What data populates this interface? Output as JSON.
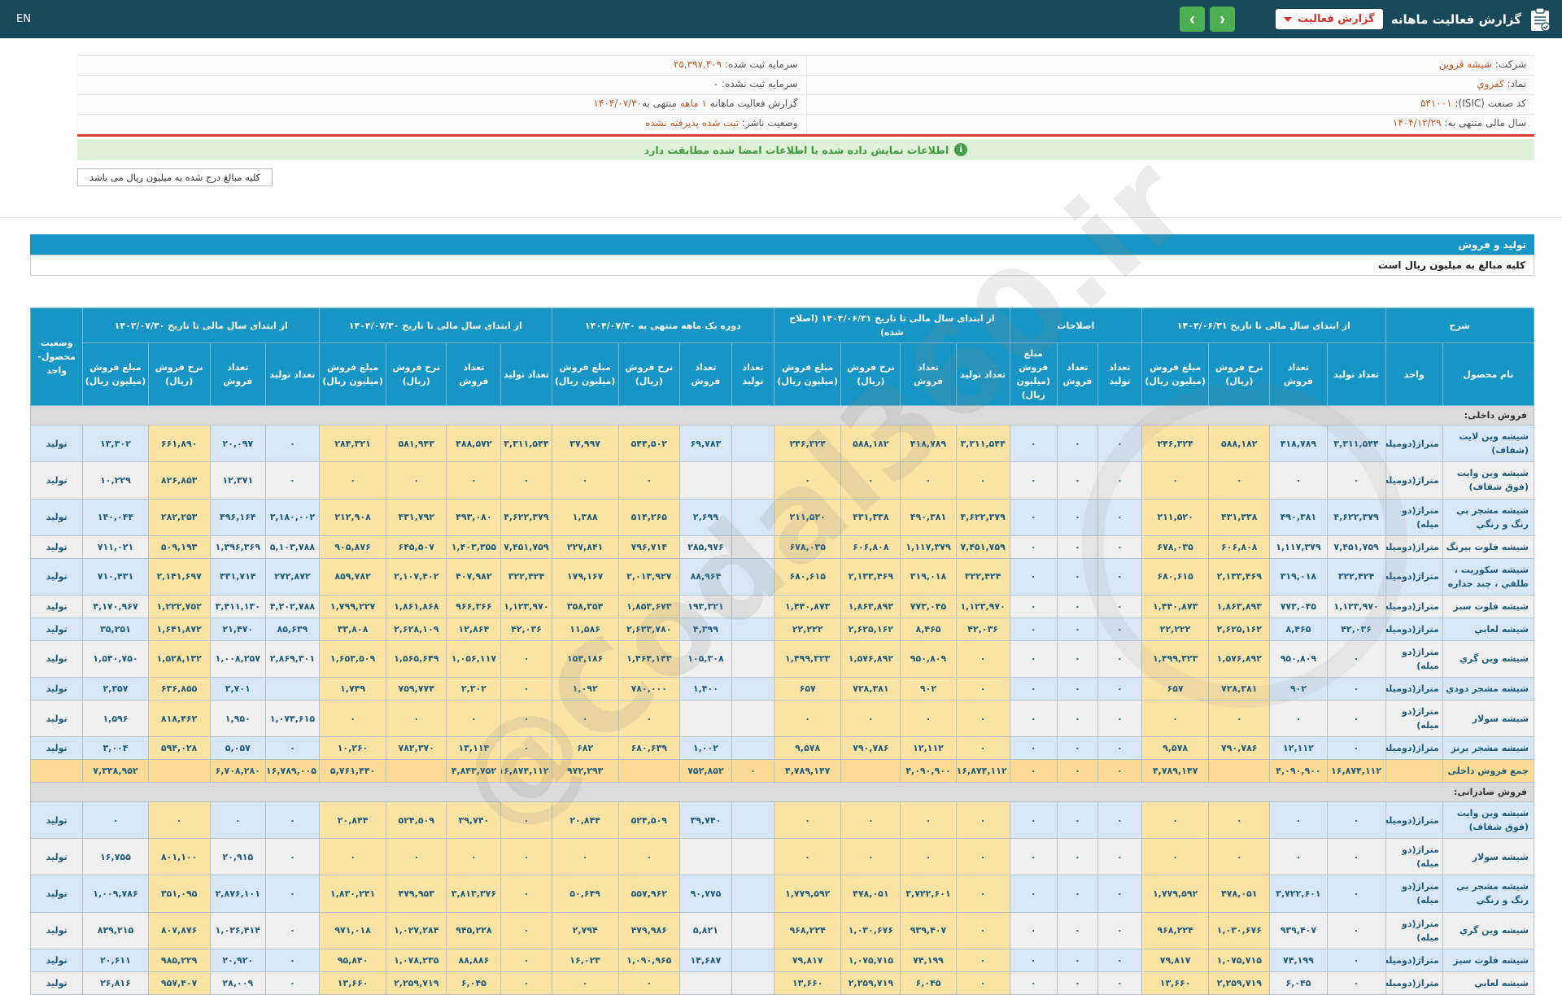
{
  "topbar": {
    "language": "EN",
    "title": "گزارش فعالیت ماهانه",
    "dropdown_label": "گزارش فعالیت",
    "icons": {
      "report": "clipboard-icon",
      "dropdown_caret": "chevron-down-icon",
      "nav_prev": "chevron-left-icon",
      "nav_next": "chevron-right-icon"
    },
    "colors": {
      "bar": "#17495A",
      "nav_button": "#4CAF50",
      "dropdown_text": "#D6342C"
    }
  },
  "info": {
    "company_label": "شرکت:",
    "company": "شیشه قزوین",
    "symbol_label": "نماد:",
    "symbol": "کفزوي",
    "isic_label": "کد صنعت (ISIC):",
    "isic": "۵۴۱۰۰۱",
    "fiscal_label": "سال مالی منتهی به:",
    "fiscal": "۱۴۰۴/۱۲/۲۹",
    "cap_reg_label": "سرمایه ثبت شده:",
    "cap_reg": "۲۵,۳۹۷,۴۰۹",
    "cap_unreg_label": "سرمایه ثبت نشده:",
    "cap_unreg": "۰",
    "report_label": "گزارش فعالیت ماهانه",
    "report_period": "۱ ماهه",
    "report_to": "منتهی به",
    "report_date": "۱۴۰۴/۰۷/۳۰",
    "status_label": "وضعیت ناشر:",
    "status": "ثبت شده پذیرفته نشده"
  },
  "notice": {
    "signed": "اطلاعات نمایش داده شده با اطلاعات امضا شده مطابقت دارد",
    "amounts_box": "کلیه مبالغ درج شده به میلیون ریال می باشد"
  },
  "section": {
    "title": "تولید و فروش",
    "note": "کلیه مبالغ به میلیون ریال است"
  },
  "watermark": {
    "text": "@Codal360.ir"
  },
  "table": {
    "head": [
      {
        "label": "شرح",
        "cols": [
          "نام محصول",
          "واحد"
        ]
      },
      {
        "label": "از ابتدای سال مالی تا تاریخ ۱۴۰۴/۰۶/۳۱",
        "cols": [
          "تعداد تولید",
          "تعداد فروش",
          "نرخ فروش (ریال)",
          "مبلغ فروش (میلیون ریال)"
        ]
      },
      {
        "label": "اصلاحات",
        "cols": [
          "تعداد تولید",
          "تعداد فروش",
          "مبلغ فروش (میلیون ریال)"
        ]
      },
      {
        "label": "از ابتدای سال مالی تا تاریخ ۱۴۰۴/۰۶/۳۱ (اصلاح شده)",
        "cols": [
          "تعداد تولید",
          "تعداد فروش",
          "نرخ فروش (ریال)",
          "مبلغ فروش (میلیون ریال)"
        ]
      },
      {
        "label": "دوره یک ماهه منتهی به ۱۴۰۴/۰۷/۳۰",
        "cols": [
          "تعداد تولید",
          "تعداد فروش",
          "نرخ فروش (ریال)",
          "مبلغ فروش (میلیون ریال)"
        ]
      },
      {
        "label": "از ابتدای سال مالی تا تاریخ ۱۴۰۴/۰۷/۳۰",
        "cols": [
          "تعداد تولید",
          "تعداد فروش",
          "نرخ فروش (ریال)",
          "مبلغ فروش (میلیون ریال)"
        ]
      },
      {
        "label": "از ابتدای سال مالی تا تاریخ ۱۴۰۳/۰۷/۳۰",
        "cols": [
          "تعداد تولید",
          "تعداد فروش",
          "نرخ فروش (ریال)",
          "مبلغ فروش (میلیون ریال)"
        ]
      },
      {
        "label": "وضعیت محصول-واحد",
        "cols": []
      }
    ],
    "sections": [
      {
        "label": "فروش داخلی:",
        "rows": [
          {
            "name": "شیشه وین لایت (شفاف)",
            "unit": "متراژ(دومیله)",
            "status": "تولید",
            "g2": [
              "۳,۳۱۱,۵۴۴",
              "۴۱۸,۷۸۹",
              "۵۸۸,۱۸۲",
              "۲۴۶,۳۲۴"
            ],
            "adj": [
              "۰",
              "۰",
              "۰"
            ],
            "g4": [
              "۳,۳۱۱,۵۴۴",
              "۴۱۸,۷۸۹",
              "۵۸۸,۱۸۲",
              "۲۴۶,۳۲۴"
            ],
            "g5": [
              "",
              "۶۹,۷۸۳",
              "۵۴۴,۵۰۲",
              "۳۷,۹۹۷"
            ],
            "g6": [
              "۳,۳۱۱,۵۴۴",
              "۴۸۸,۵۷۲",
              "۵۸۱,۹۴۳",
              "۲۸۴,۳۲۱"
            ],
            "g7": [
              "۰",
              "۲۰,۰۹۷",
              "۶۶۱,۸۹۰",
              "۱۳,۳۰۲"
            ]
          },
          {
            "name": "شیشه وین وایت (فوق شفاف)",
            "unit": "متراژ(دومیله)",
            "status": "تولید",
            "g2": [
              "۰",
              "۰",
              "۰",
              "۰"
            ],
            "adj": [
              "۰",
              "۰",
              "۰"
            ],
            "g4": [
              "۰",
              "۰",
              "۰",
              "۰"
            ],
            "g5": [
              "",
              "",
              "۰",
              "۰"
            ],
            "g6": [
              "۰",
              "۰",
              "۰",
              "۰"
            ],
            "g7": [
              "۰",
              "۱۲,۳۷۱",
              "۸۲۶,۸۵۳",
              "۱۰,۲۲۹"
            ]
          },
          {
            "name": "شیشه مشجر بي رنگ و رنگي",
            "unit": "متراژ(دو میله)",
            "status": "تولید",
            "g2": [
              "۴,۶۲۲,۳۷۹",
              "۴۹۰,۳۸۱",
              "۴۳۱,۳۳۸",
              "۲۱۱,۵۲۰"
            ],
            "adj": [
              "۰",
              "۰",
              "۰"
            ],
            "g4": [
              "۴,۶۲۲,۳۷۹",
              "۴۹۰,۳۸۱",
              "۴۳۱,۳۳۸",
              "۲۱۱,۵۲۰"
            ],
            "g5": [
              "",
              "۲,۶۹۹",
              "۵۱۴,۲۶۵",
              "۱,۳۸۸"
            ],
            "g6": [
              "۴,۶۲۲,۳۷۹",
              "۴۹۳,۰۸۰",
              "۴۳۱,۷۹۲",
              "۲۱۲,۹۰۸"
            ],
            "g7": [
              "۳,۱۸۰,۰۰۲",
              "۴۹۶,۱۶۴",
              "۲۸۲,۲۵۳",
              "۱۴۰,۰۴۴"
            ]
          },
          {
            "name": "شیشه فلوت بیرنگ",
            "unit": "متراژ(دومیله)",
            "status": "تولید",
            "g2": [
              "۷,۴۵۱,۷۵۹",
              "۱,۱۱۷,۳۷۹",
              "۶۰۶,۸۰۸",
              "۶۷۸,۰۳۵"
            ],
            "adj": [
              "۰",
              "۰",
              "۰"
            ],
            "g4": [
              "۷,۴۵۱,۷۵۹",
              "۱,۱۱۷,۳۷۹",
              "۶۰۶,۸۰۸",
              "۶۷۸,۰۳۵"
            ],
            "g5": [
              "",
              "۲۸۵,۹۷۶",
              "۷۹۶,۷۱۴",
              "۲۲۷,۸۴۱"
            ],
            "g6": [
              "۷,۴۵۱,۷۵۹",
              "۱,۴۰۳,۳۵۵",
              "۶۴۵,۵۰۷",
              "۹۰۵,۸۷۶"
            ],
            "g7": [
              "۵,۱۰۳,۷۸۸",
              "۱,۳۹۶,۳۶۹",
              "۵۰۹,۱۹۳",
              "۷۱۱,۰۲۱"
            ]
          },
          {
            "name": "شیشه سکوریت ، طلقي ، چند جداره",
            "unit": "متراژ(دومیله)",
            "status": "تولید",
            "g2": [
              "۳۲۲,۴۲۴",
              "۳۱۹,۰۱۸",
              "۲,۱۳۳,۴۶۹",
              "۶۸۰,۶۱۵"
            ],
            "adj": [
              "۰",
              "۰",
              "۰"
            ],
            "g4": [
              "۳۲۲,۴۲۴",
              "۳۱۹,۰۱۸",
              "۲,۱۳۳,۴۶۹",
              "۶۸۰,۶۱۵"
            ],
            "g5": [
              "",
              "۸۸,۹۶۴",
              "۲,۰۱۳,۹۲۷",
              "۱۷۹,۱۶۷"
            ],
            "g6": [
              "۳۲۲,۴۲۴",
              "۴۰۷,۹۸۲",
              "۲,۱۰۷,۴۰۲",
              "۸۵۹,۷۸۲"
            ],
            "g7": [
              "۲۷۲,۸۷۲",
              "۳۳۱,۷۱۴",
              "۲,۱۴۱,۶۹۷",
              "۷۱۰,۴۳۱"
            ]
          },
          {
            "name": "شیشه فلوت سبز",
            "unit": "متراژ(دومیله)",
            "status": "تولید",
            "g2": [
              "۱,۱۲۳,۹۷۰",
              "۷۷۳,۰۴۵",
              "۱,۸۶۳,۸۹۳",
              "۱,۴۴۰,۸۷۳"
            ],
            "adj": [
              "۰",
              "۰",
              "۰"
            ],
            "g4": [
              "۱,۱۲۳,۹۷۰",
              "۷۷۳,۰۴۵",
              "۱,۸۶۳,۸۹۳",
              "۱,۴۴۰,۸۷۳"
            ],
            "g5": [
              "",
              "۱۹۳,۳۲۱",
              "۱,۸۵۳,۶۷۳",
              "۳۵۸,۳۵۴"
            ],
            "g6": [
              "۱,۱۲۳,۹۷۰",
              "۹۶۶,۳۶۶",
              "۱,۸۶۱,۸۶۸",
              "۱,۷۹۹,۲۲۷"
            ],
            "g7": [
              "۴,۲۰۲,۷۸۸",
              "۳,۴۱۱,۱۳۰",
              "۱,۲۲۲,۷۵۲",
              "۴,۱۷۰,۹۶۷"
            ]
          },
          {
            "name": "شیشه لعابي",
            "unit": "متراژ(دومیله)",
            "status": "تولید",
            "g2": [
              "۴۲,۰۳۶",
              "۸,۴۶۵",
              "۲,۶۲۵,۱۶۲",
              "۲۲,۲۲۲"
            ],
            "adj": [
              "۰",
              "۰",
              "۰"
            ],
            "g4": [
              "۴۲,۰۳۶",
              "۸,۴۶۵",
              "۲,۶۲۵,۱۶۲",
              "۲۲,۲۲۲"
            ],
            "g5": [
              "",
              "۴,۳۹۹",
              "۲,۶۳۳,۷۸۰",
              "۱۱,۵۸۶"
            ],
            "g6": [
              "۴۲,۰۳۶",
              "۱۲,۸۶۴",
              "۲,۶۲۸,۱۰۹",
              "۳۳,۸۰۸"
            ],
            "g7": [
              "۸۵,۶۳۹",
              "۲۱,۴۷۰",
              "۱,۶۴۱,۸۷۲",
              "۳۵,۲۵۱"
            ]
          },
          {
            "name": "شیشه وین گري",
            "unit": "متراژ(دو میله)",
            "status": "تولید",
            "g2": [
              "۰",
              "۹۵۰,۸۰۹",
              "۱,۵۷۶,۸۹۲",
              "۱,۴۹۹,۳۲۳"
            ],
            "adj": [
              "۰",
              "۰",
              "۰"
            ],
            "g4": [
              "۰",
              "۹۵۰,۸۰۹",
              "۱,۵۷۶,۸۹۲",
              "۱,۴۹۹,۳۲۳"
            ],
            "g5": [
              "",
              "۱۰۵,۳۰۸",
              "۱,۴۶۴,۱۴۳",
              "۱۵۴,۱۸۶"
            ],
            "g6": [
              "۰",
              "۱,۰۵۶,۱۱۷",
              "۱,۵۶۵,۶۴۹",
              "۱,۶۵۳,۵۰۹"
            ],
            "g7": [
              "۲,۸۶۹,۳۰۱",
              "۱,۰۰۸,۲۵۷",
              "۱,۵۲۸,۱۳۲",
              "۱,۵۴۰,۷۵۰"
            ]
          },
          {
            "name": "شیشه مشجر دودي",
            "unit": "متراژ(دومیله)",
            "status": "تولید",
            "g2": [
              "۰",
              "۹۰۲",
              "۷۲۸,۳۸۱",
              "۶۵۷"
            ],
            "adj": [
              "۰",
              "۰",
              "۰"
            ],
            "g4": [
              "۰",
              "۹۰۲",
              "۷۲۸,۳۸۱",
              "۶۵۷"
            ],
            "g5": [
              "",
              "۱,۴۰۰",
              "۷۸۰,۰۰۰",
              "۱,۰۹۲"
            ],
            "g6": [
              "۰",
              "۲,۳۰۲",
              "۷۵۹,۷۷۴",
              "۱,۷۴۹"
            ],
            "g7": [
              "",
              "۳,۷۰۱",
              "۶۳۶,۸۵۵",
              "۲,۳۵۷"
            ]
          },
          {
            "name": "شیشه سولار",
            "unit": "متراژ(دو میله)",
            "status": "تولید",
            "g2": [
              "۰",
              "۰",
              "۰",
              "۰"
            ],
            "adj": [
              "۰",
              "۰",
              "۰"
            ],
            "g4": [
              "۰",
              "۰",
              "۰",
              "۰"
            ],
            "g5": [
              "",
              "",
              "۰",
              "۰"
            ],
            "g6": [
              "۰",
              "۰",
              "۰",
              "۰"
            ],
            "g7": [
              "۱,۰۷۴,۶۱۵",
              "۱,۹۵۰",
              "۸۱۸,۴۶۲",
              "۱,۵۹۶"
            ]
          },
          {
            "name": "شیشه مشجر برنز",
            "unit": "متراژ(دومیله)",
            "status": "تولید",
            "g2": [
              "۰",
              "۱۲,۱۱۲",
              "۷۹۰,۷۸۶",
              "۹,۵۷۸"
            ],
            "adj": [
              "۰",
              "۰",
              "۰"
            ],
            "g4": [
              "۰",
              "۱۲,۱۱۲",
              "۷۹۰,۷۸۶",
              "۹,۵۷۸"
            ],
            "g5": [
              "",
              "۱,۰۰۲",
              "۶۸۰,۶۳۹",
              "۶۸۲"
            ],
            "g6": [
              "۰",
              "۱۳,۱۱۴",
              "۷۸۲,۳۷۰",
              "۱۰,۲۶۰"
            ],
            "g7": [
              "۰",
              "۵,۰۵۷",
              "۵۹۴,۰۲۸",
              "۳,۰۰۴"
            ]
          },
          {
            "name": "جمع فروش داخلی",
            "unit": "",
            "status": "",
            "total": true,
            "g2": [
              "۱۶,۸۷۴,۱۱۲",
              "۴,۰۹۰,۹۰۰",
              "",
              "۴,۷۸۹,۱۴۷"
            ],
            "adj": [
              "۰",
              "۰",
              "۰"
            ],
            "g4": [
              "۱۶,۸۷۴,۱۱۲",
              "۴,۰۹۰,۹۰۰",
              "",
              "۴,۷۸۹,۱۴۷"
            ],
            "g5": [
              "۰",
              "۷۵۲,۸۵۲",
              "",
              "۹۷۲,۲۹۳"
            ],
            "g6": [
              "۱۶,۸۷۴,۱۱۲",
              "۴,۸۴۳,۷۵۲",
              "",
              "۵,۷۶۱,۴۴۰"
            ],
            "g7": [
              "۱۶,۷۸۹,۰۰۵",
              "۶,۷۰۸,۲۸۰",
              "",
              "۷,۳۳۸,۹۵۲"
            ]
          }
        ]
      },
      {
        "label": "فروش صادراتی:",
        "rows": [
          {
            "name": "شیشه وین وایت (فوق شفاف)",
            "unit": "متراژ(دومیله)",
            "status": "تولید",
            "g2": [
              "۰",
              "۰",
              "۰",
              "۰"
            ],
            "adj": [
              "۰",
              "۰",
              "۰"
            ],
            "g4": [
              "۰",
              "۰",
              "۰",
              "۰"
            ],
            "g5": [
              "",
              "۳۹,۷۴۰",
              "۵۲۴,۵۰۹",
              "۲۰,۸۴۴"
            ],
            "g6": [
              "۰",
              "۳۹,۷۴۰",
              "۵۲۴,۵۰۹",
              "۲۰,۸۴۴"
            ],
            "g7": [
              "۰",
              "۰",
              "۰",
              "۰"
            ]
          },
          {
            "name": "شیشه سولار",
            "unit": "متراژ(دو میله)",
            "status": "تولید",
            "g2": [
              "۰",
              "۰",
              "۰",
              "۰"
            ],
            "adj": [
              "۰",
              "۰",
              "۰"
            ],
            "g4": [
              "۰",
              "۰",
              "۰",
              "۰"
            ],
            "g5": [
              "",
              "",
              "۰",
              "۰"
            ],
            "g6": [
              "۰",
              "۰",
              "۰",
              "۰"
            ],
            "g7": [
              "۰",
              "۲۰,۹۱۵",
              "۸۰۱,۱۰۰",
              "۱۶,۷۵۵"
            ]
          },
          {
            "name": "شیشه مشجر بي رنگ و رنگي",
            "unit": "متراژ(دو میله)",
            "status": "تولید",
            "g2": [
              "۰",
              "۳,۷۲۲,۶۰۱",
              "۴۷۸,۰۵۱",
              "۱,۷۷۹,۵۹۲"
            ],
            "adj": [
              "۰",
              "۰",
              "۰"
            ],
            "g4": [
              "۰",
              "۳,۷۲۲,۶۰۱",
              "۴۷۸,۰۵۱",
              "۱,۷۷۹,۵۹۲"
            ],
            "g5": [
              "",
              "۹۰,۷۷۵",
              "۵۵۷,۹۶۲",
              "۵۰,۶۴۹"
            ],
            "g6": [
              "۰",
              "۳,۸۱۳,۳۷۶",
              "۴۷۹,۹۵۳",
              "۱,۸۳۰,۲۴۱"
            ],
            "g7": [
              "۰",
              "۲,۸۷۶,۱۰۱",
              "۳۵۱,۰۹۵",
              "۱,۰۰۹,۷۸۶"
            ]
          },
          {
            "name": "شیشه وین گري",
            "unit": "متراژ(دو میله)",
            "status": "تولید",
            "g2": [
              "۰",
              "۹۳۹,۴۰۷",
              "۱,۰۳۰,۶۷۶",
              "۹۶۸,۲۲۴"
            ],
            "adj": [
              "۰",
              "۰",
              "۰"
            ],
            "g4": [
              "۰",
              "۹۳۹,۴۰۷",
              "۱,۰۳۰,۶۷۶",
              "۹۶۸,۲۲۴"
            ],
            "g5": [
              "",
              "۵,۸۲۱",
              "۴۷۹,۹۸۶",
              "۲,۷۹۴"
            ],
            "g6": [
              "۰",
              "۹۴۵,۲۲۸",
              "۱,۰۲۷,۲۸۴",
              "۹۷۱,۰۱۸"
            ],
            "g7": [
              "۰",
              "۱,۰۲۶,۴۱۴",
              "۸۰۷,۸۷۶",
              "۸۲۹,۲۱۵"
            ]
          },
          {
            "name": "شیشه فلوت سبز",
            "unit": "متراژ(دومیله)",
            "status": "تولید",
            "g2": [
              "۰",
              "۷۴,۱۹۹",
              "۱,۰۷۵,۷۱۵",
              "۷۹,۸۱۷"
            ],
            "adj": [
              "۰",
              "۰",
              "۰"
            ],
            "g4": [
              "۰",
              "۷۴,۱۹۹",
              "۱,۰۷۵,۷۱۵",
              "۷۹,۸۱۷"
            ],
            "g5": [
              "",
              "۱۴,۶۸۷",
              "۱,۰۹۰,۹۶۵",
              "۱۶,۰۲۳"
            ],
            "g6": [
              "۰",
              "۸۸,۸۸۶",
              "۱,۰۷۸,۲۳۵",
              "۹۵,۸۴۰"
            ],
            "g7": [
              "۰",
              "۲۰,۹۲۰",
              "۹۸۵,۲۲۹",
              "۲۰,۶۱۱"
            ]
          },
          {
            "name": "شیشه لعابي",
            "unit": "متراژ(دومیله)",
            "status": "تولید",
            "g2": [
              "۰",
              "۶,۰۴۵",
              "۲,۲۵۹,۷۱۹",
              "۱۳,۶۶۰"
            ],
            "adj": [
              "۰",
              "۰",
              "۰"
            ],
            "g4": [
              "۰",
              "۶,۰۴۵",
              "۲,۲۵۹,۷۱۹",
              "۱۳,۶۶۰"
            ],
            "g5": [
              "",
              "",
              "۰",
              "۰"
            ],
            "g6": [
              "۰",
              "۶,۰۴۵",
              "۲,۲۵۹,۷۱۹",
              "۱۳,۶۶۰"
            ],
            "g7": [
              "۰",
              "۲۸,۰۰۹",
              "۹۵۷,۴۰۷",
              "۲۶,۸۱۶"
            ]
          }
        ]
      }
    ]
  }
}
